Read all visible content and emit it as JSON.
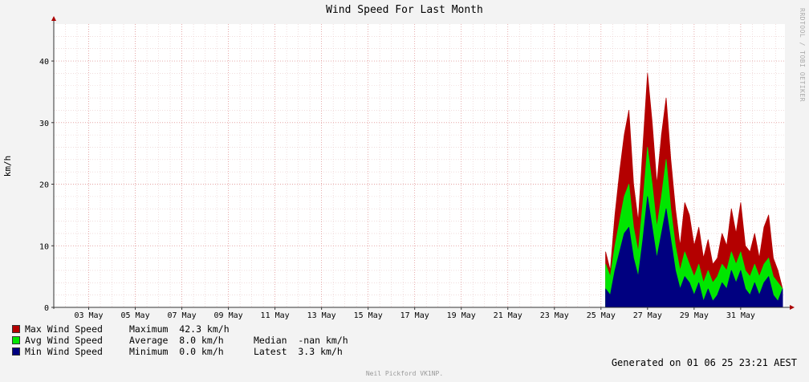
{
  "page": {
    "title": "Wind Speed For Last Month",
    "side_label": "RRDTOOL / TOBI OETIKER",
    "generated": "Generated on 01 06 25 23:21 AEST",
    "credit": "Neil Pickford VK1NP."
  },
  "legend": [
    {
      "name": "Max Wind Speed",
      "color": "#b40000",
      "stat1": "Maximum  42.3 km/h",
      "stat2": ""
    },
    {
      "name": "Avg Wind Speed",
      "color": "#00e600",
      "stat1": "Average  8.0 km/h",
      "stat2": "Median  -nan km/h"
    },
    {
      "name": "Min Wind Speed",
      "color": "#000080",
      "stat1": "Minimum  0.0 km/h",
      "stat2": "Latest  3.3 km/h"
    }
  ],
  "chart_data": {
    "type": "area",
    "ylabel": "km/h",
    "ylim": [
      0,
      46
    ],
    "yticks": [
      0,
      10,
      20,
      30,
      40
    ],
    "xlim": [
      1.5,
      32.9
    ],
    "xticks": [
      {
        "day": 3,
        "label": "03 May"
      },
      {
        "day": 5,
        "label": "05 May"
      },
      {
        "day": 7,
        "label": "07 May"
      },
      {
        "day": 9,
        "label": "09 May"
      },
      {
        "day": 11,
        "label": "11 May"
      },
      {
        "day": 13,
        "label": "13 May"
      },
      {
        "day": 15,
        "label": "15 May"
      },
      {
        "day": 17,
        "label": "17 May"
      },
      {
        "day": 19,
        "label": "19 May"
      },
      {
        "day": 21,
        "label": "21 May"
      },
      {
        "day": 23,
        "label": "23 May"
      },
      {
        "day": 25,
        "label": "25 May"
      },
      {
        "day": 27,
        "label": "27 May"
      },
      {
        "day": 29,
        "label": "29 May"
      },
      {
        "day": 31,
        "label": "31 May"
      }
    ],
    "grid": true,
    "series": [
      {
        "name": "Max Wind Speed",
        "color": "#b40000",
        "x": [
          25.2,
          25.4,
          25.6,
          25.8,
          26.0,
          26.2,
          26.4,
          26.6,
          26.8,
          27.0,
          27.2,
          27.4,
          27.6,
          27.8,
          28.0,
          28.2,
          28.4,
          28.6,
          28.8,
          29.0,
          29.2,
          29.4,
          29.6,
          29.8,
          30.0,
          30.2,
          30.4,
          30.6,
          30.8,
          31.0,
          31.2,
          31.4,
          31.6,
          31.8,
          32.0,
          32.2,
          32.4,
          32.6,
          32.8
        ],
        "values": [
          9,
          6,
          15,
          22,
          28,
          32,
          20,
          14,
          26,
          38,
          30,
          20,
          28,
          34,
          24,
          16,
          10,
          17,
          15,
          10,
          13,
          8,
          11,
          7,
          8,
          12,
          10,
          16,
          12,
          17,
          10,
          9,
          12,
          8,
          13,
          15,
          8,
          6,
          3
        ]
      },
      {
        "name": "Avg Wind Speed",
        "color": "#00e600",
        "x": [
          25.2,
          25.4,
          25.6,
          25.8,
          26.0,
          26.2,
          26.4,
          26.6,
          26.8,
          27.0,
          27.2,
          27.4,
          27.6,
          27.8,
          28.0,
          28.2,
          28.4,
          28.6,
          28.8,
          29.0,
          29.2,
          29.4,
          29.6,
          29.8,
          30.0,
          30.2,
          30.4,
          30.6,
          30.8,
          31.0,
          31.2,
          31.4,
          31.6,
          31.8,
          32.0,
          32.2,
          32.4,
          32.6,
          32.8
        ],
        "values": [
          7,
          5,
          10,
          14,
          18,
          20,
          13,
          9,
          17,
          26,
          20,
          13,
          18,
          24,
          16,
          10,
          6,
          9,
          7,
          5,
          7,
          4,
          6,
          4,
          5,
          7,
          6,
          9,
          7,
          9,
          6,
          5,
          7,
          5,
          7,
          8,
          5,
          4,
          3
        ]
      },
      {
        "name": "Min Wind Speed",
        "color": "#000080",
        "x": [
          25.2,
          25.4,
          25.6,
          25.8,
          26.0,
          26.2,
          26.4,
          26.6,
          26.8,
          27.0,
          27.2,
          27.4,
          27.6,
          27.8,
          28.0,
          28.2,
          28.4,
          28.6,
          28.8,
          29.0,
          29.2,
          29.4,
          29.6,
          29.8,
          30.0,
          30.2,
          30.4,
          30.6,
          30.8,
          31.0,
          31.2,
          31.4,
          31.6,
          31.8,
          32.0,
          32.2,
          32.4,
          32.6,
          32.8
        ],
        "values": [
          3,
          2,
          6,
          9,
          12,
          13,
          8,
          5,
          11,
          18,
          13,
          8,
          12,
          16,
          11,
          6,
          3,
          5,
          4,
          2,
          4,
          1,
          3,
          1,
          2,
          4,
          3,
          6,
          4,
          6,
          3,
          2,
          4,
          2,
          4,
          5,
          2,
          1,
          3
        ]
      }
    ]
  }
}
